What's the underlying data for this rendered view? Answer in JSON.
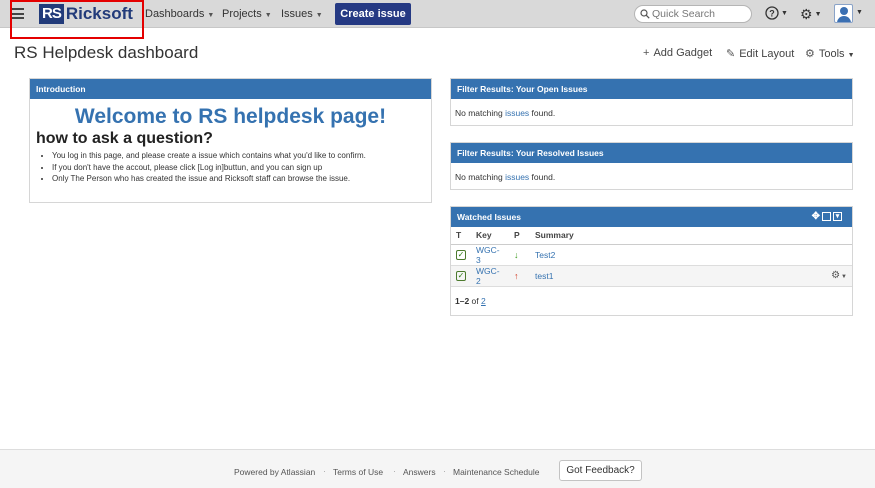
{
  "header": {
    "logo_mark": "RS",
    "logo_text": "Ricksoft",
    "nav": [
      {
        "label": "Dashboards"
      },
      {
        "label": "Projects"
      },
      {
        "label": "Issues"
      }
    ],
    "create_label": "Create issue",
    "search_placeholder": "Quick Search"
  },
  "page": {
    "title": "RS Helpdesk dashboard",
    "tools": {
      "add_gadget": "Add Gadget",
      "edit_layout": "Edit Layout",
      "tools": "Tools"
    }
  },
  "intro": {
    "title": "Introduction",
    "welcome": "Welcome to RS helpdesk page!",
    "ask": "how to ask a question?",
    "bullets": [
      "You log in this page, and please create a issue which contains what you'd like to confirm.",
      "If you don't have the accout, please click [Log in]buttun, and you can sign up",
      "Only The Person who has created the issue and Ricksoft staff can browse the issue."
    ]
  },
  "open_issues": {
    "title": "Filter Results: Your Open Issues",
    "msg_pre": "No matching ",
    "msg_link": "issues",
    "msg_post": " found."
  },
  "resolved_issues": {
    "title": "Filter Results: Your Resolved Issues",
    "msg_pre": "No matching ",
    "msg_link": "issues",
    "msg_post": " found."
  },
  "watched": {
    "title": "Watched Issues",
    "columns": {
      "t": "T",
      "key": "Key",
      "p": "P",
      "summary": "Summary"
    },
    "rows": [
      {
        "key": "WGC-3",
        "priority": "low",
        "summary": "Test2"
      },
      {
        "key": "WGC-2",
        "priority": "high",
        "summary": "test1"
      }
    ],
    "paging": {
      "range": "1–2",
      "of": " of ",
      "total": "2"
    }
  },
  "footer": {
    "powered": "Powered by Atlassian",
    "terms": "Terms of Use",
    "answers": "Answers",
    "maintenance": "Maintenance Schedule",
    "feedback": "Got Feedback?"
  },
  "colors": {
    "header_bg": "#d9d9d9",
    "brand": "#223b7a",
    "create_button": "#253983",
    "gadget_title": "#3572b0",
    "highlight_box": "#e40000"
  }
}
